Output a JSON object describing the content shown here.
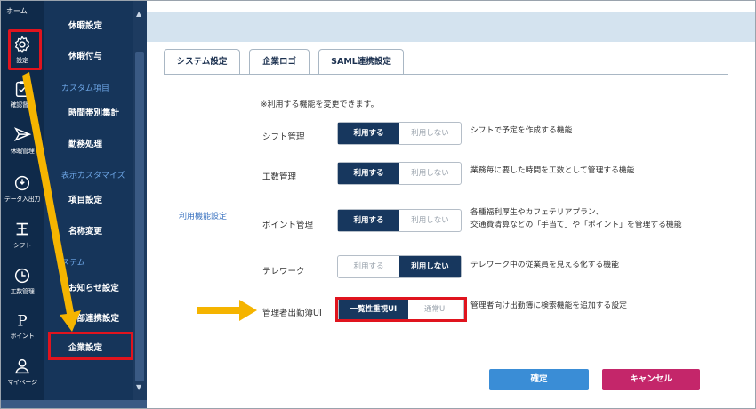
{
  "rail": {
    "home": "ホーム",
    "items": [
      {
        "label": "設定",
        "icon": "gear-icon"
      },
      {
        "label": "確認督促",
        "icon": "clipboard-icon"
      },
      {
        "label": "休暇管理",
        "icon": "paper-plane-icon"
      },
      {
        "label": "データ入出力",
        "icon": "power-icon"
      },
      {
        "label": "シフト",
        "icon": "shift-icon"
      },
      {
        "label": "工数管理",
        "icon": "clock-icon"
      },
      {
        "label": "ポイント",
        "icon": "point-icon"
      },
      {
        "label": "マイページ",
        "icon": "user-icon"
      }
    ]
  },
  "submenu": {
    "items": [
      {
        "label": "休暇設定",
        "type": "item"
      },
      {
        "label": "休暇付与",
        "type": "item"
      },
      {
        "label": "カスタム項目",
        "type": "section"
      },
      {
        "label": "時間帯別集計",
        "type": "item"
      },
      {
        "label": "勤務処理",
        "type": "item"
      },
      {
        "label": "表示カスタマイズ",
        "type": "section"
      },
      {
        "label": "項目設定",
        "type": "item"
      },
      {
        "label": "名称変更",
        "type": "item"
      },
      {
        "label": "ステム",
        "type": "section"
      },
      {
        "label": "お知らせ設定",
        "type": "item"
      },
      {
        "label": "外部連携設定",
        "type": "item"
      },
      {
        "label": "企業設定",
        "type": "item"
      }
    ]
  },
  "tabs": [
    "システム設定",
    "企業ロゴ",
    "SAML連携設定"
  ],
  "note": "※利用する機能を変更できます。",
  "group_label": "利用機能設定",
  "rows": [
    {
      "label": "シフト管理",
      "on": "利用する",
      "off": "利用しない",
      "selected": "left",
      "desc1": "シフトで予定を作成する機能",
      "desc2": ""
    },
    {
      "label": "工数管理",
      "on": "利用する",
      "off": "利用しない",
      "selected": "left",
      "desc1": "業務毎に要した時間を工数として管理する機能",
      "desc2": ""
    },
    {
      "label": "ポイント管理",
      "on": "利用する",
      "off": "利用しない",
      "selected": "left",
      "desc1": "各種福利厚生やカフェテリアプラン、",
      "desc2": "交通費清算などの「手当て」や「ポイント」を管理する機能"
    },
    {
      "label": "テレワーク",
      "on": "利用する",
      "off": "利用しない",
      "selected": "right",
      "desc1": "テレワーク中の従業員を見える化する機能",
      "desc2": ""
    },
    {
      "label": "管理者出勤簿UI",
      "on": "一覧性重視UI",
      "off": "通常UI",
      "selected": "left",
      "desc1": "管理者向け出勤簿に検索機能を追加する設定",
      "desc2": ""
    }
  ],
  "buttons": {
    "ok": "確定",
    "cancel": "キャンセル"
  },
  "colors": {
    "rail": "#0f2a4a",
    "submenu": "#16355a",
    "highlight": "#e0141e",
    "arrow": "#f5b400",
    "ok": "#3a8dd6",
    "cancel": "#c4266a"
  }
}
